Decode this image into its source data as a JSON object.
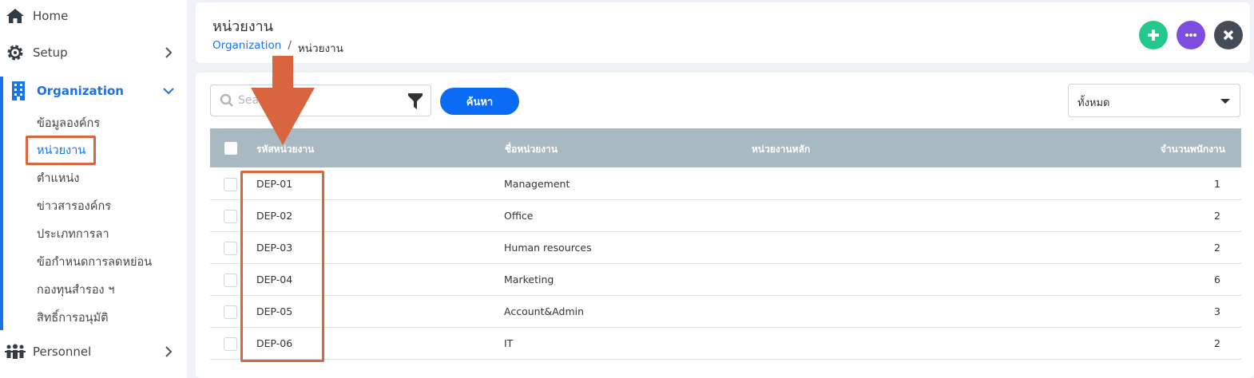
{
  "sidebar": {
    "items": [
      {
        "label": "Home",
        "icon": "home-icon"
      },
      {
        "label": "Setup",
        "icon": "gear-icon"
      },
      {
        "label": "Organization",
        "icon": "building-icon"
      },
      {
        "label": "Personnel",
        "icon": "people-icon"
      }
    ],
    "org_sub_items": [
      {
        "label": "ข้อมูลองค์กร"
      },
      {
        "label": "หน่วยงาน"
      },
      {
        "label": "ตำแหน่ง"
      },
      {
        "label": "ข่าวสารองค์กร"
      },
      {
        "label": "ประเภทการลา"
      },
      {
        "label": "ข้อกำหนดการลดหย่อน"
      },
      {
        "label": "กองทุนสำรอง ฯ"
      },
      {
        "label": "สิทธิ์การอนุมัติ"
      }
    ],
    "active_sub_item": "หน่วยงาน"
  },
  "header": {
    "title": "หน่วยงาน",
    "breadcrumb": {
      "link": "Organization",
      "separator": "/",
      "current": "หน่วยงาน"
    }
  },
  "toolbar": {
    "search_placeholder": "Search",
    "search_button": "ค้นหา",
    "filter_value": "ทั้งหมด"
  },
  "table": {
    "columns": [
      "รหัสหน่วยงาน",
      "ชื่อหน่วยงาน",
      "หน่วยงานหลัก",
      "จำนวนพนักงาน"
    ],
    "rows": [
      {
        "code": "DEP-01",
        "name": "Management",
        "parent": "",
        "count": "1"
      },
      {
        "code": "DEP-02",
        "name": "Office",
        "parent": "",
        "count": "2"
      },
      {
        "code": "DEP-03",
        "name": "Human resources",
        "parent": "",
        "count": "2"
      },
      {
        "code": "DEP-04",
        "name": "Marketing",
        "parent": "",
        "count": "6"
      },
      {
        "code": "DEP-05",
        "name": "Account&Admin",
        "parent": "",
        "count": "3"
      },
      {
        "code": "DEP-06",
        "name": "IT",
        "parent": "",
        "count": "2"
      }
    ]
  },
  "colors": {
    "accent": "#1a73e8",
    "add_button": "#22c98a",
    "more_button": "#7c4ddf",
    "close_button": "#444d55",
    "table_header": "#a9b9c2",
    "annotation": "#d9653f"
  }
}
